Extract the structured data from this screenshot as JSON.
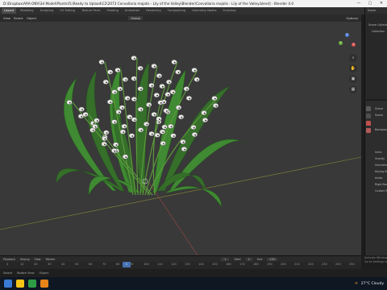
{
  "window": {
    "title": "D:\\Dropbox\\ARA-ONV\\3d Model\\Plants\\FL\\Ready to Upload\\C2\\2073 Convallaria majalis - Lily of the Valley\\Blender\\Convallaria majalis - Lily of the Valley.blend] - Blender 4.0",
    "minimize": "—",
    "maximize": "▢",
    "close": "✕"
  },
  "workspaces": [
    "Layout",
    "Modeling",
    "Sculpting",
    "UV Editing",
    "Texture Paint",
    "Shading",
    "Animation",
    "Rendering",
    "Compositing",
    "Geometry Nodes",
    "Scripting"
  ],
  "scene_label": "Scene",
  "header": {
    "mode": "Object Mode",
    "view": "View",
    "select": "Select",
    "add": "Add",
    "object": "Object",
    "transform": "Global",
    "options": "Options"
  },
  "gizmo": {
    "x": "X",
    "y": "Y",
    "z": "Z"
  },
  "outliner": {
    "root": "Scene Collection",
    "collection": "Collection"
  },
  "properties": {
    "scene": "Scene",
    "items": [
      "Scene",
      "Units",
      "Gravity",
      "Simulation",
      "Keying Sets",
      "Audio",
      "Rigid Body World",
      "Custom Properties"
    ],
    "background_label": "Background"
  },
  "timeline": {
    "menu": [
      "Playback",
      "Keying",
      "View",
      "Marker"
    ],
    "frames": [
      "0",
      "10",
      "20",
      "30",
      "40",
      "50",
      "60",
      "70",
      "80",
      "90",
      "100",
      "110",
      "120",
      "130",
      "140",
      "150",
      "160",
      "170",
      "180",
      "190",
      "200",
      "210",
      "220",
      "230",
      "240",
      "250"
    ],
    "current_frame": "1",
    "start_label": "Start",
    "start": "1",
    "end_label": "End",
    "end": "250"
  },
  "status": {
    "select": "Select",
    "rotate": "Rotate View",
    "menu": "Object"
  },
  "activate": {
    "line1": "Activate Windows",
    "line2": "Go to Settings to activate Windows."
  },
  "taskbar": {
    "weather": "27°C Cloudy",
    "colors": [
      "#3a7bd5",
      "#f5c518",
      "#2e9e44",
      "#e8841a"
    ]
  },
  "colors": {
    "accent": "#4772b3",
    "viewport": "#393939",
    "leaf": "#3f8a32",
    "flower": "#e8e8e4"
  }
}
